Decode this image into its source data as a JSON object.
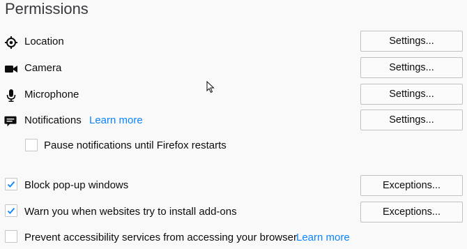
{
  "section": {
    "title": "Permissions"
  },
  "permissions": [
    {
      "label": "Location",
      "icon": "location-icon",
      "button": "Settings..."
    },
    {
      "label": "Camera",
      "icon": "camera-icon",
      "button": "Settings..."
    },
    {
      "label": "Microphone",
      "icon": "microphone-icon",
      "button": "Settings..."
    },
    {
      "label": "Notifications",
      "icon": "notifications-icon",
      "button": "Settings...",
      "learn_more": "Learn more"
    }
  ],
  "pause_notifications": {
    "label": "Pause notifications until Firefox restarts",
    "checked": false
  },
  "block_popups": {
    "label": "Block pop-up windows",
    "checked": true,
    "button": "Exceptions..."
  },
  "warn_addons": {
    "label": "Warn you when websites try to install add-ons",
    "checked": true,
    "button": "Exceptions..."
  },
  "prevent_accessibility": {
    "label": "Prevent accessibility services from accessing your browser",
    "checked": false,
    "learn_more": "Learn more"
  },
  "colors": {
    "link": "#0a84ff",
    "checkmark": "#0a84ff",
    "background": "#f9f9fa"
  }
}
